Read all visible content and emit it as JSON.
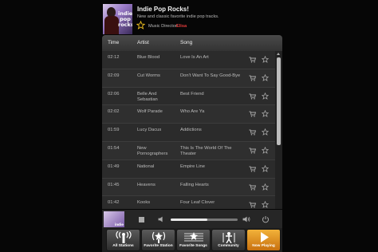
{
  "station": {
    "title": "Indie Pop Rocks!",
    "description": "New and classic favorite indie pop tracks.",
    "art_text": "indie pop rocks!",
    "music_director_label": "Music Director:",
    "music_director_name": "Elisa"
  },
  "playlist": {
    "headers": {
      "time": "Time",
      "artist": "Artist",
      "song": "Song"
    },
    "rows": [
      {
        "time": "02:12",
        "artist": "Blue Blood",
        "song": "Love Is An Art"
      },
      {
        "time": "02:09",
        "artist": "Cut Worms",
        "song": "Don't Want To Say Good-Bye"
      },
      {
        "time": "02:06",
        "artist": "Belle And Sebastian",
        "song": "Best Friend"
      },
      {
        "time": "02:02",
        "artist": "Wolf Parade",
        "song": "Who Are Ya"
      },
      {
        "time": "01:59",
        "artist": "Lucy Dacus",
        "song": "Addictions"
      },
      {
        "time": "01:54",
        "artist": "New Pornographers",
        "song": "This Is The World Of The Theater"
      },
      {
        "time": "01:49",
        "artist": "National",
        "song": "Empire Line"
      },
      {
        "time": "01:45",
        "artist": "Heavens",
        "song": "Falling Hearts"
      },
      {
        "time": "01:42",
        "artist": "Kooks",
        "song": "Four Leaf Clover"
      }
    ]
  },
  "player": {
    "now_playing_art_text": "indie",
    "volume_level": 0.55
  },
  "nav": [
    {
      "label": "All Stations",
      "icon": "radio-waves-icon",
      "active": false
    },
    {
      "label": "Favorite Station",
      "icon": "radio-star-icon",
      "active": false
    },
    {
      "label": "Favorite Songs",
      "icon": "music-staff-icon",
      "active": false
    },
    {
      "label": "Community",
      "icon": "community-icon",
      "active": false
    },
    {
      "label": "Now Playing",
      "icon": "play-icon",
      "active": true
    }
  ],
  "colors": {
    "accent": "#e8961e",
    "director_name": "#e23b3b"
  }
}
